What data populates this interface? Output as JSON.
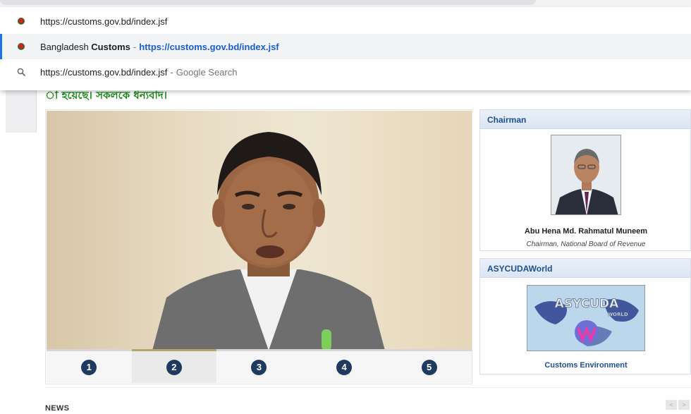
{
  "omnibox": {
    "suggestions": [
      {
        "icon": "favicon-icon",
        "text": "https://customs.gov.bd/index.jsf"
      },
      {
        "icon": "favicon-icon",
        "title_prefix": "Bangladesh ",
        "title_bold": "Customs",
        "separator": "-",
        "url": "https://customs.gov.bd/index.jsf"
      },
      {
        "icon": "search-icon",
        "text": "https://customs.gov.bd/index.jsf",
        "separator": "-",
        "suffix": "Google Search"
      }
    ]
  },
  "page": {
    "headline": "া হয়েছে। সকলকে ধন্যবাদ।",
    "slider": {
      "thumbs": [
        "1",
        "2",
        "3",
        "4",
        "5"
      ],
      "active_index": 1
    },
    "chairman_panel": {
      "title": "Chairman",
      "name": "Abu Hena Md. Rahmatul Muneem",
      "designation": "Chairman, National Board of Revenue"
    },
    "asycuda_panel": {
      "title": "ASYCUDAWorld",
      "logo_text": "ASYCUDA",
      "logo_subtext": "WORLD",
      "caption": "Customs Environment"
    },
    "news_label": "NEWS",
    "pager": [
      "<",
      ">"
    ]
  },
  "colors": {
    "headline_green": "#1b8b1b",
    "panel_title_blue": "#1f4e8c",
    "link_blue": "#1a5fcc",
    "thumb_badge": "#1e3a5f"
  }
}
